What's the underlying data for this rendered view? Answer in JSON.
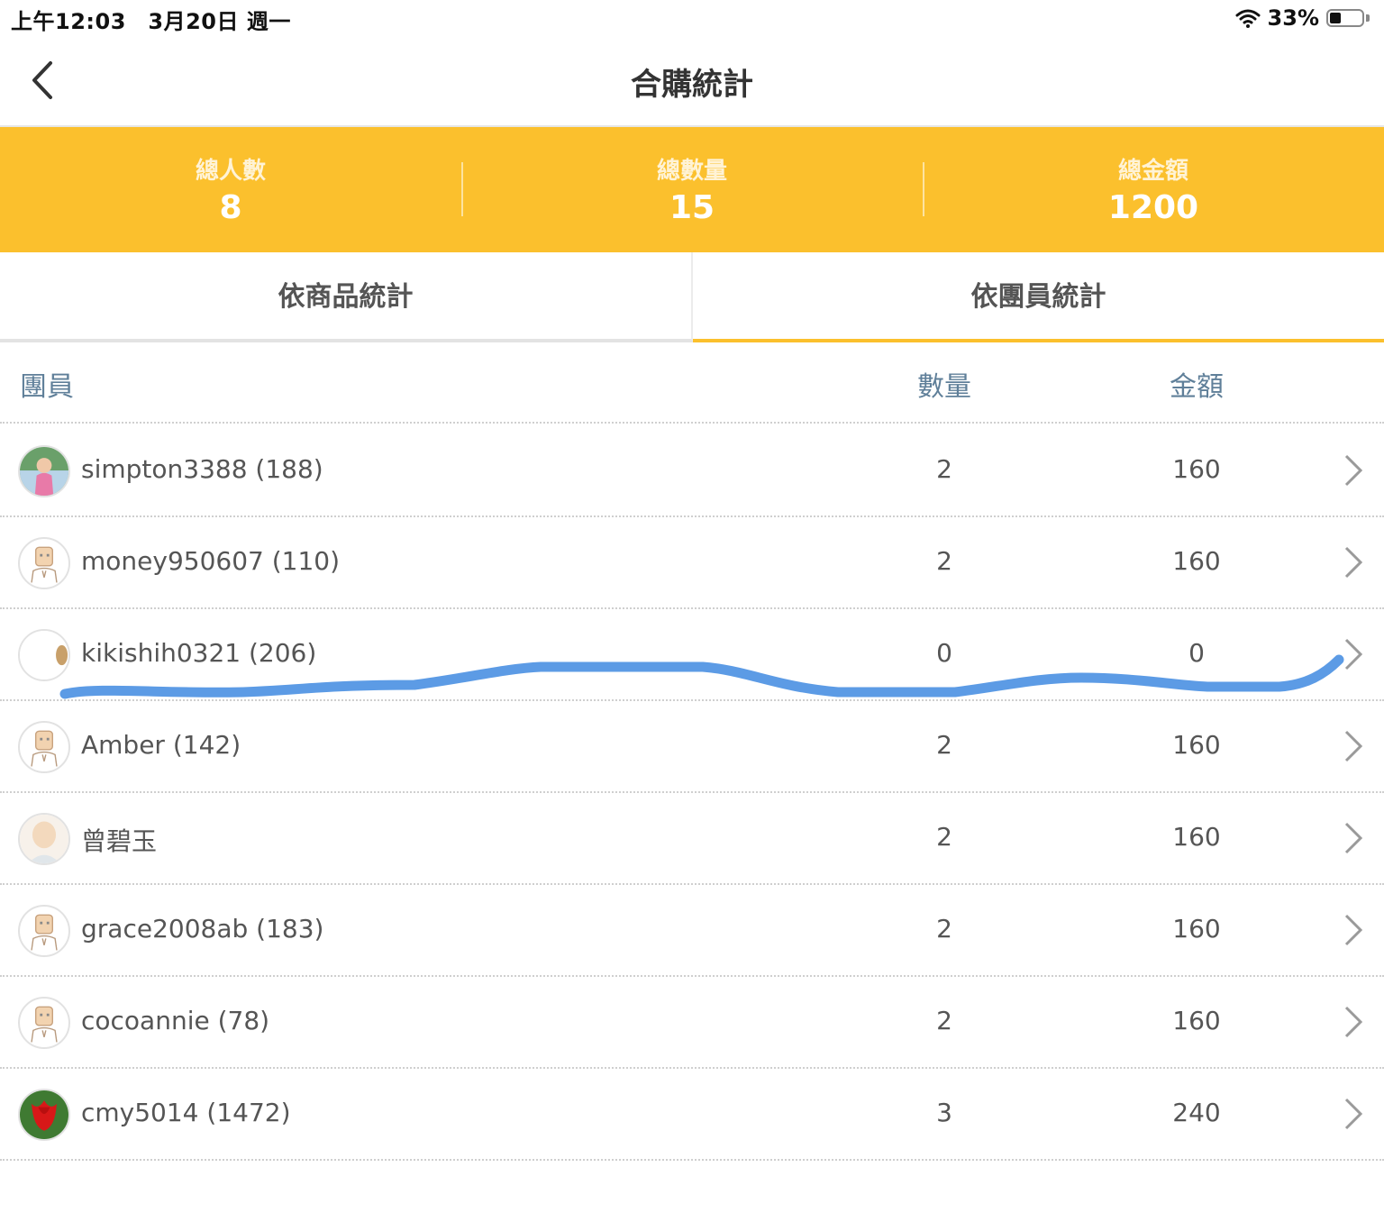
{
  "status_bar": {
    "time": "上午12:03　3月20日 週一",
    "battery": "33%",
    "icons": [
      "wifi-icon",
      "battery-icon"
    ]
  },
  "nav": {
    "title": "合購統計",
    "back_icon": "chevron-left-icon"
  },
  "summary": {
    "people_label": "總人數",
    "people_value": "8",
    "quantity_label": "總數量",
    "quantity_value": "15",
    "amount_label": "總金額",
    "amount_value": "1200"
  },
  "tabs": [
    {
      "label": "依商品統計",
      "active": false
    },
    {
      "label": "依團員統計",
      "active": true
    }
  ],
  "table": {
    "headers": {
      "member": "團員",
      "quantity": "數量",
      "amount": "金額"
    },
    "rows": [
      {
        "name": "simpton3388 (188)",
        "quantity": "2",
        "amount": "160",
        "avatar": "photo-avatar"
      },
      {
        "name": "money950607 (110)",
        "quantity": "2",
        "amount": "160",
        "avatar": "default-avatar"
      },
      {
        "name": "kikishih0321 (206)",
        "quantity": "0",
        "amount": "0",
        "avatar": "partial-avatar"
      },
      {
        "name": "Amber (142)",
        "quantity": "2",
        "amount": "160",
        "avatar": "default-avatar"
      },
      {
        "name": "曾碧玉",
        "quantity": "2",
        "amount": "160",
        "avatar": "blurred-avatar"
      },
      {
        "name": "grace2008ab (183)",
        "quantity": "2",
        "amount": "160",
        "avatar": "default-avatar"
      },
      {
        "name": "cocoannie (78)",
        "quantity": "2",
        "amount": "160",
        "avatar": "default-avatar"
      },
      {
        "name": "cmy5014 (1472)",
        "quantity": "3",
        "amount": "240",
        "avatar": "tulip-avatar"
      }
    ]
  },
  "colors": {
    "accent": "#FBC02D",
    "header_text": "#5f7f99",
    "annotation_stroke": "#4a90e2"
  }
}
